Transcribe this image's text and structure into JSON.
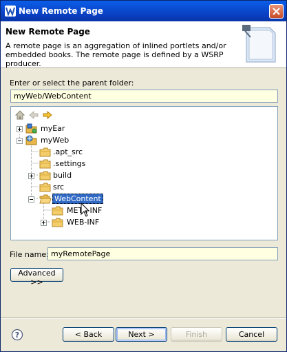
{
  "window": {
    "title": "New Remote Page"
  },
  "header": {
    "title": "New Remote Page",
    "description": "A remote page is an aggregation of inlined portlets and/or embedded books. The remote page is defined by a WSRP producer."
  },
  "parent_folder": {
    "label": "Enter or select the parent folder:",
    "value": "myWeb/WebContent"
  },
  "tree": {
    "nodes": [
      {
        "label": "myEar"
      },
      {
        "label": "myWeb"
      },
      {
        "label": ".apt_src"
      },
      {
        "label": ".settings"
      },
      {
        "label": "build"
      },
      {
        "label": "src"
      },
      {
        "label": "WebContent"
      },
      {
        "label": "META-INF"
      },
      {
        "label": "WEB-INF"
      }
    ]
  },
  "file_name": {
    "label": "File name:",
    "value": "myRemotePage"
  },
  "buttons": {
    "advanced": "Advanced >>",
    "back": "< Back",
    "next": "Next >",
    "finish": "Finish",
    "cancel": "Cancel"
  },
  "colors": {
    "selection": "#316ac5",
    "input_bg": "#ffffe1",
    "folder": "#e8b84a"
  }
}
